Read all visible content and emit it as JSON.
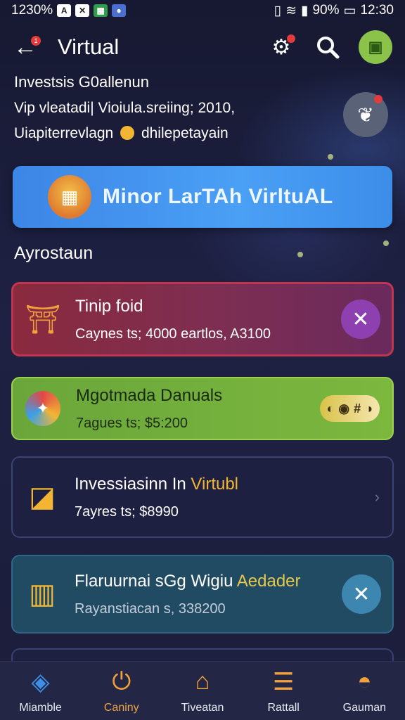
{
  "status_bar": {
    "left_text": "1230%",
    "right_battery": "90%",
    "time": "12:30"
  },
  "top_bar": {
    "title": "Virtual",
    "back_badge": "1"
  },
  "info": {
    "title": "Investsis G0allenun",
    "line1": "Vip vleatadi| Vioiula.sreiing; 2010,",
    "line2_a": "Uiapiterrevlagn",
    "line2_b": "dhilepetayain"
  },
  "banner": {
    "label": "Minor LarTAh VirltuAL"
  },
  "section": {
    "label": "Ayrostaun"
  },
  "cards": [
    {
      "title": "Tinip foid",
      "subtitle": "Caynes ts; 4000 eartlos, A3100",
      "action_icon": "close-icon"
    },
    {
      "title": "Mgotmada Danuals",
      "subtitle": "7agues ts; $5:200",
      "pill_text": "#"
    },
    {
      "title_a": "Invessiasinn In ",
      "title_b": "Virtubl",
      "subtitle": "7ayres ts; $8990"
    },
    {
      "title_a": "Flaruurnai sGg Wigiu ",
      "title_b": "Aedader",
      "subtitle": "Rayanstiacan s, 338200",
      "action_icon": "close-icon"
    }
  ],
  "bottom_nav": [
    {
      "label": "Miamble",
      "icon": "box-icon"
    },
    {
      "label": "Caniny",
      "icon": "power-icon",
      "active": true
    },
    {
      "label": "Tiveatan",
      "icon": "home-icon"
    },
    {
      "label": "Rattall",
      "icon": "stack-icon"
    },
    {
      "label": "Gauman",
      "icon": "person-icon"
    }
  ],
  "colors": {
    "background": "#1b1d3a",
    "accent": "#f2a23a",
    "banner": "#4aa0f5",
    "card_green": "#7cb83e",
    "card_red": "#8a2a3e"
  }
}
